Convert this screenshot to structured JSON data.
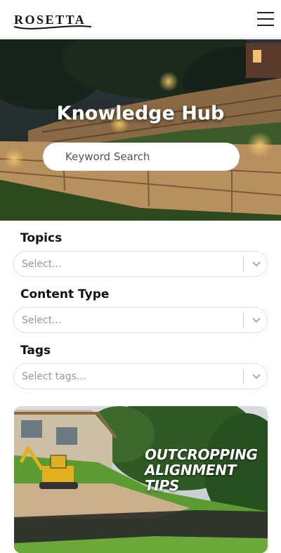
{
  "header": {
    "logo_text": "ROSETTA"
  },
  "hero": {
    "title": "Knowledge Hub",
    "search_placeholder": "Keyword Search"
  },
  "filters": [
    {
      "label": "Topics",
      "placeholder": "Select..."
    },
    {
      "label": "Content Type",
      "placeholder": "Select..."
    },
    {
      "label": "Tags",
      "placeholder": "Select tags..."
    }
  ],
  "card": {
    "title_lines": [
      "OUTCROPPING",
      "ALIGNMENT",
      "TIPS"
    ]
  },
  "icons": {
    "menu": "hamburger-menu-icon",
    "dropdown": "chevron-down-icon"
  }
}
